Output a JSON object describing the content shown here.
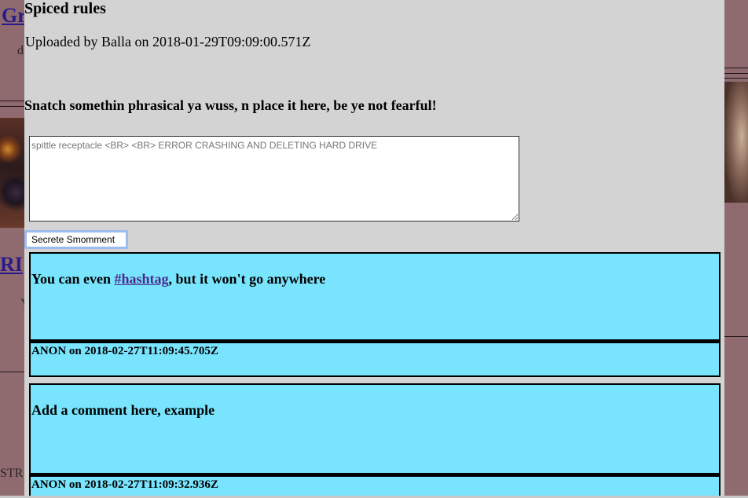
{
  "background": {
    "link1": "Gr",
    "text1": "d",
    "link2": "RI",
    "text2": "Y",
    "text3": "STR"
  },
  "modal": {
    "title": "Spiced rules",
    "uploaded_line": "Uploaded by Balla on 2018-01-29T09:09:00.571Z",
    "prompt": "Snatch somethin phrasical ya wuss, n place it here, be ye not fearful!",
    "comment_placeholder": "spittle receptacle <BR> <BR> ERROR CRASHING AND DELETING HARD DRIVE",
    "submit_label": "Secrete Smomment"
  },
  "comments": [
    {
      "text_before": "You can even ",
      "hashtag": "#hashtag",
      "text_after": ", but it won't go anywhere",
      "meta": "ANON on 2018-02-27T11:09:45.705Z"
    },
    {
      "text": "Add a comment here, example",
      "meta": "ANON on 2018-02-27T11:09:32.936Z"
    }
  ],
  "colors": {
    "overlay_bg": "#8f6b70",
    "modal_bg": "#d3d3d3",
    "card_bg": "#78e4fd",
    "link": "#4b2a8c"
  }
}
